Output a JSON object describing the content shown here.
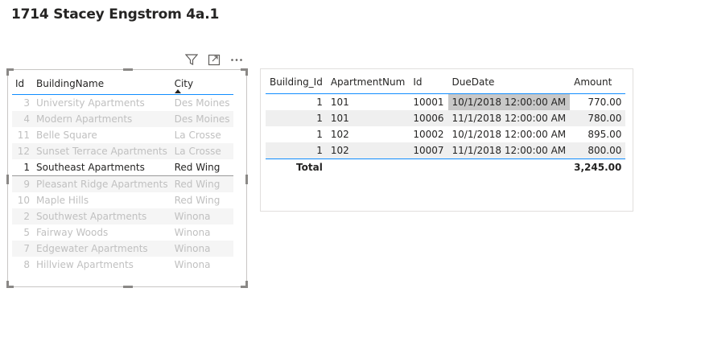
{
  "page": {
    "title": "1714 Stacey Engstrom 4a.1"
  },
  "visual_header": {
    "icons": [
      "filter-icon",
      "focus-mode-icon",
      "more-options-icon"
    ]
  },
  "buildings_table": {
    "columns": [
      "Id",
      "BuildingName",
      "City"
    ],
    "sorted_column": "City",
    "rows": [
      {
        "id": "3",
        "name": "University Apartments",
        "city": "Des Moines",
        "selected": false
      },
      {
        "id": "4",
        "name": "Modern Apartments",
        "city": "Des Moines",
        "selected": false
      },
      {
        "id": "11",
        "name": "Belle Square",
        "city": "La Crosse",
        "selected": false
      },
      {
        "id": "12",
        "name": "Sunset Terrace Apartments",
        "city": "La Crosse",
        "selected": false
      },
      {
        "id": "1",
        "name": "Southeast Apartments",
        "city": "Red Wing",
        "selected": true
      },
      {
        "id": "9",
        "name": "Pleasant Ridge Apartments",
        "city": "Red Wing",
        "selected": false
      },
      {
        "id": "10",
        "name": "Maple Hills",
        "city": "Red Wing",
        "selected": false
      },
      {
        "id": "2",
        "name": "Southwest Apartments",
        "city": "Winona",
        "selected": false
      },
      {
        "id": "5",
        "name": "Fairway Woods",
        "city": "Winona",
        "selected": false
      },
      {
        "id": "7",
        "name": "Edgewater Apartments",
        "city": "Winona",
        "selected": false
      },
      {
        "id": "8",
        "name": "Hillview Apartments",
        "city": "Winona",
        "selected": false
      }
    ]
  },
  "invoices_table": {
    "columns": [
      "Building_Id",
      "ApartmentNum",
      "Id",
      "DueDate",
      "Amount"
    ],
    "rows": [
      {
        "building_id": "1",
        "apartment": "101",
        "id": "10001",
        "due": "10/1/2018 12:00:00 AM",
        "amount": "770.00"
      },
      {
        "building_id": "1",
        "apartment": "101",
        "id": "10006",
        "due": "11/1/2018 12:00:00 AM",
        "amount": "780.00"
      },
      {
        "building_id": "1",
        "apartment": "102",
        "id": "10002",
        "due": "10/1/2018 12:00:00 AM",
        "amount": "895.00"
      },
      {
        "building_id": "1",
        "apartment": "102",
        "id": "10007",
        "due": "11/1/2018 12:00:00 AM",
        "amount": "800.00"
      }
    ],
    "total_label": "Total",
    "total_amount": "3,245.00"
  }
}
